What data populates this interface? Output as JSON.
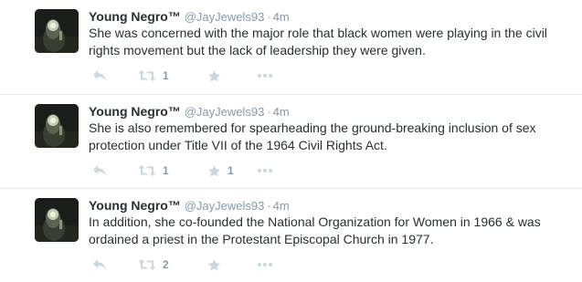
{
  "tweets": [
    {
      "fullname": "Young Negro™",
      "username": "@JayJewels93",
      "separator": "·",
      "time": "4m",
      "text": "She was concerned with the major role that black women were playing in the civil rights movement but the lack of leadership they were given.",
      "retweet_count": "1",
      "favorite_count": ""
    },
    {
      "fullname": "Young Negro™",
      "username": "@JayJewels93",
      "separator": "·",
      "time": "4m",
      "text": "She is also remembered for spearheading the ground-breaking inclusion of sex protection under Title VII of the 1964 Civil Rights Act.",
      "retweet_count": "1",
      "favorite_count": "1"
    },
    {
      "fullname": "Young Negro™",
      "username": "@JayJewels93",
      "separator": "·",
      "time": "4m",
      "text": "In addition, she co-founded the National Organization for Women in 1966 & was ordained a priest in the Protestant Episcopal Church in 1977.",
      "retweet_count": "2",
      "favorite_count": ""
    }
  ],
  "icons": {
    "reply": "reply-icon",
    "retweet": "retweet-icon",
    "favorite": "star-icon",
    "more": "more-dots-icon"
  },
  "colors": {
    "name": "#292f33",
    "meta": "#8899a6",
    "icon": "#ccd6dd",
    "divider": "#e1e8ed"
  }
}
